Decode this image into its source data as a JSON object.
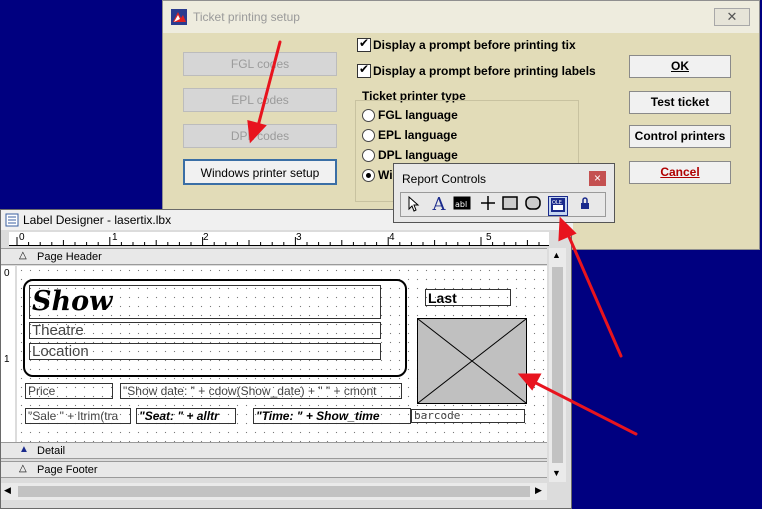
{
  "setup_dialog": {
    "title": "Ticket printing setup",
    "left_buttons": [
      "FGL codes",
      "EPL codes",
      "DPL codes",
      "Windows printer setup"
    ],
    "checkboxes": [
      "Display a prompt before printing tix",
      "Display a prompt before printing labels"
    ],
    "printer_type_label": "Ticket printer type",
    "radios": [
      "FGL language",
      "EPL language",
      "DPL language",
      "Wi"
    ],
    "right_buttons": [
      "OK",
      "Test ticket",
      "Control printers",
      "Cancel"
    ]
  },
  "designer": {
    "title": "Label Designer - lasertix.lbx",
    "ruler_numbers": [
      "0",
      "1",
      "2",
      "3",
      "4",
      "5"
    ],
    "vruler_numbers": [
      "0",
      "1"
    ],
    "bands": {
      "page_header": "Page Header",
      "detail": "Detail",
      "page_footer": "Page Footer"
    },
    "fields": {
      "show": "Show",
      "theatre": "Theatre",
      "location": "Location",
      "last": "Last",
      "price": "Price",
      "show_date": "\"Show date: \" + cdow(Show_date) + \" \" + cmont",
      "sale": "\"Sale \" + ltrim(tra",
      "seat": "\"Seat: \" + alltr",
      "time": "\"Time: \" + Show_time",
      "barcode": "barcode"
    }
  },
  "report_controls": {
    "title": "Report Controls"
  },
  "colors": {
    "desktop": "#000080",
    "arrow": "#e8141e",
    "dialog": "#e2dcb8"
  }
}
